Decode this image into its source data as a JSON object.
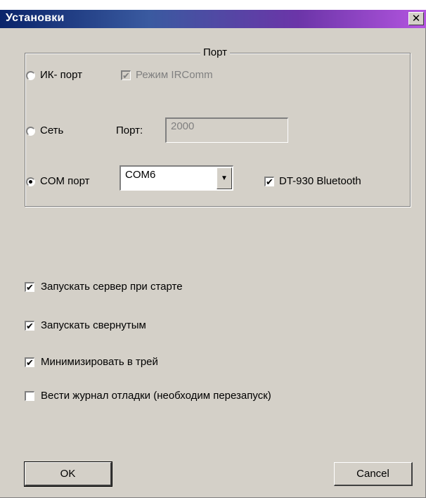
{
  "window": {
    "title": "Установки",
    "close_glyph": "✕"
  },
  "port_group": {
    "legend": "Порт",
    "ir": {
      "radio_label": "ИК- порт",
      "selected": false,
      "irda_checkbox_label": "Режим IRComm",
      "irda_checked": true,
      "irda_enabled": false
    },
    "network": {
      "radio_label": "Сеть",
      "selected": false,
      "port_label": "Порт:",
      "port_value": "2000"
    },
    "com": {
      "radio_label": "COM порт",
      "selected": true,
      "combo_value": "COM6",
      "bluetooth_label": "DT-930 Bluetooth",
      "bluetooth_checked": true
    }
  },
  "options": [
    {
      "label": "Запускать сервер при старте",
      "checked": true
    },
    {
      "label": "Запускать свернутым",
      "checked": true
    },
    {
      "label": "Минимизировать в трей",
      "checked": true
    },
    {
      "label": "Вести журнал отладки (необходим перезапуск)",
      "checked": false
    }
  ],
  "buttons": {
    "ok": "OK",
    "cancel": "Cancel"
  }
}
